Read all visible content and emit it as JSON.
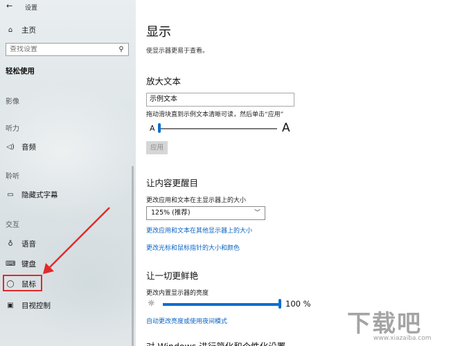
{
  "window": {
    "title": "设置",
    "back_icon": "back-arrow-icon"
  },
  "sidebar": {
    "home": {
      "label": "主页",
      "icon": "home-icon"
    },
    "search": {
      "placeholder": "查找设置",
      "icon": "search-icon"
    },
    "group_title": "轻松使用",
    "sections": {
      "vision": "影像",
      "hearing": "听力",
      "hearing2": "聆听",
      "interaction": "交互"
    },
    "items": {
      "audio": {
        "label": "音频",
        "icon": "speaker-icon"
      },
      "captions": {
        "label": "隐藏式字幕",
        "icon": "captions-icon"
      },
      "speech": {
        "label": "语音",
        "icon": "microphone-icon"
      },
      "keyboard": {
        "label": "键盘",
        "icon": "keyboard-icon"
      },
      "mouse": {
        "label": "鼠标",
        "icon": "mouse-icon"
      },
      "eye_control": {
        "label": "目视控制",
        "icon": "eye-control-icon"
      }
    }
  },
  "main": {
    "title": "显示",
    "description": "使显示器更易于查看。",
    "enlarge_text": {
      "heading": "放大文本",
      "sample_text": "示例文本",
      "instruction": "拖动滑块直到示例文本清晰可读，然后单击“应用”",
      "min_label": "A",
      "max_label": "A",
      "slider_value": 0,
      "apply_button": "应用"
    },
    "make_bigger": {
      "heading": "让内容更醒目",
      "scale_label": "更改应用和文本在主显示器上的大小",
      "scale_value": "125% (推荐)",
      "link1": "更改应用和文本在其他显示器上的大小",
      "link2": "更改光标和鼠标指针的大小和颜色"
    },
    "brighter": {
      "heading": "让一切更鲜艳",
      "brightness_label": "更改内置显示器的亮度",
      "brightness_value": "100 %",
      "brightness_level": 1.0,
      "night_light_link": "自动更改亮度或使用夜间模式"
    },
    "next_heading_partial": "对 Windows 进行简化和个性化设置"
  },
  "watermark": {
    "main": "下载吧",
    "sub": "www.xiazaiba.com"
  },
  "colors": {
    "accent": "#0a6fd1",
    "link": "#0a64c2",
    "annotation_red": "#e02a2a"
  }
}
